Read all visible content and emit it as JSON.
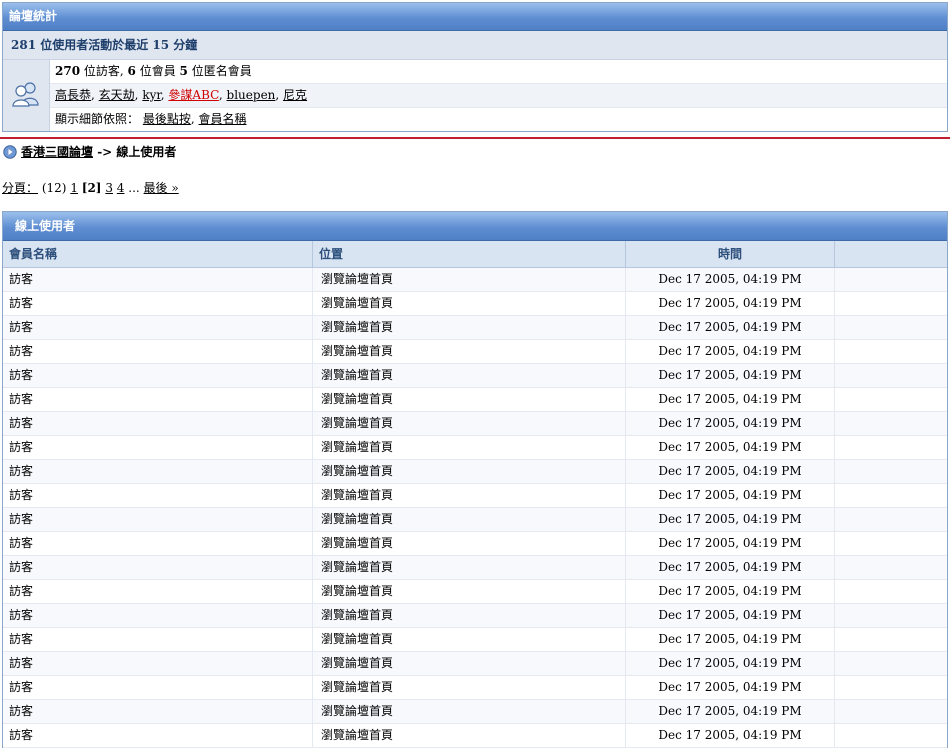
{
  "stats": {
    "title": "論壇統計",
    "active_summary": "281 位使用者活動於最近 15 分鐘",
    "counts": {
      "guests_num": "270",
      "guests_label": " 位訪客, ",
      "members_num": "6",
      "members_label": " 位會員 ",
      "anon_num": "5",
      "anon_label": " 位匿名會員"
    },
    "members": [
      {
        "name": "高長恭",
        "color": "#000000"
      },
      {
        "name": "玄天劫",
        "color": "#000000"
      },
      {
        "name": "kyr",
        "color": "#000000"
      },
      {
        "name": "參謀ABC",
        "color": "#d10000"
      },
      {
        "name": "bluepen",
        "color": "#000000"
      },
      {
        "name": "尼克",
        "color": "#000000"
      }
    ],
    "sort": {
      "label": "顯示細節依照：",
      "by_last_click": "最後點按",
      "by_member_name": "會員名稱"
    }
  },
  "breadcrumb": {
    "forum_name": "香港三國論壇",
    "separator": " -> ",
    "current": "線上使用者"
  },
  "pagination": {
    "label": "分頁：",
    "total": "(12)",
    "page1": "1",
    "current": "[2]",
    "page3": "3",
    "page4": "4",
    "ellipsis": "...",
    "last": "最後 »"
  },
  "online_table": {
    "title": "線上使用者",
    "headers": {
      "name": "會員名稱",
      "location": "位置",
      "time": "時間",
      "extra": ""
    },
    "rows": [
      {
        "name": "訪客",
        "location": "瀏覽論壇首頁",
        "time": "Dec 17 2005, 04:19 PM"
      },
      {
        "name": "訪客",
        "location": "瀏覽論壇首頁",
        "time": "Dec 17 2005, 04:19 PM"
      },
      {
        "name": "訪客",
        "location": "瀏覽論壇首頁",
        "time": "Dec 17 2005, 04:19 PM"
      },
      {
        "name": "訪客",
        "location": "瀏覽論壇首頁",
        "time": "Dec 17 2005, 04:19 PM"
      },
      {
        "name": "訪客",
        "location": "瀏覽論壇首頁",
        "time": "Dec 17 2005, 04:19 PM"
      },
      {
        "name": "訪客",
        "location": "瀏覽論壇首頁",
        "time": "Dec 17 2005, 04:19 PM"
      },
      {
        "name": "訪客",
        "location": "瀏覽論壇首頁",
        "time": "Dec 17 2005, 04:19 PM"
      },
      {
        "name": "訪客",
        "location": "瀏覽論壇首頁",
        "time": "Dec 17 2005, 04:19 PM"
      },
      {
        "name": "訪客",
        "location": "瀏覽論壇首頁",
        "time": "Dec 17 2005, 04:19 PM"
      },
      {
        "name": "訪客",
        "location": "瀏覽論壇首頁",
        "time": "Dec 17 2005, 04:19 PM"
      },
      {
        "name": "訪客",
        "location": "瀏覽論壇首頁",
        "time": "Dec 17 2005, 04:19 PM"
      },
      {
        "name": "訪客",
        "location": "瀏覽論壇首頁",
        "time": "Dec 17 2005, 04:19 PM"
      },
      {
        "name": "訪客",
        "location": "瀏覽論壇首頁",
        "time": "Dec 17 2005, 04:19 PM"
      },
      {
        "name": "訪客",
        "location": "瀏覽論壇首頁",
        "time": "Dec 17 2005, 04:19 PM"
      },
      {
        "name": "訪客",
        "location": "瀏覽論壇首頁",
        "time": "Dec 17 2005, 04:19 PM"
      },
      {
        "name": "訪客",
        "location": "瀏覽論壇首頁",
        "time": "Dec 17 2005, 04:19 PM"
      },
      {
        "name": "訪客",
        "location": "瀏覽論壇首頁",
        "time": "Dec 17 2005, 04:19 PM"
      },
      {
        "name": "訪客",
        "location": "瀏覽論壇首頁",
        "time": "Dec 17 2005, 04:19 PM"
      },
      {
        "name": "訪客",
        "location": "瀏覽論壇首頁",
        "time": "Dec 17 2005, 04:19 PM"
      },
      {
        "name": "訪客",
        "location": "瀏覽論壇首頁",
        "time": "Dec 17 2005, 04:19 PM"
      }
    ]
  },
  "icons": {
    "users": "users-icon",
    "breadcrumb_arrow": "arrow-right-circle-icon"
  },
  "colors": {
    "accent": "#5f8ed2",
    "divider": "#c02030",
    "special_member": "#d10000"
  }
}
